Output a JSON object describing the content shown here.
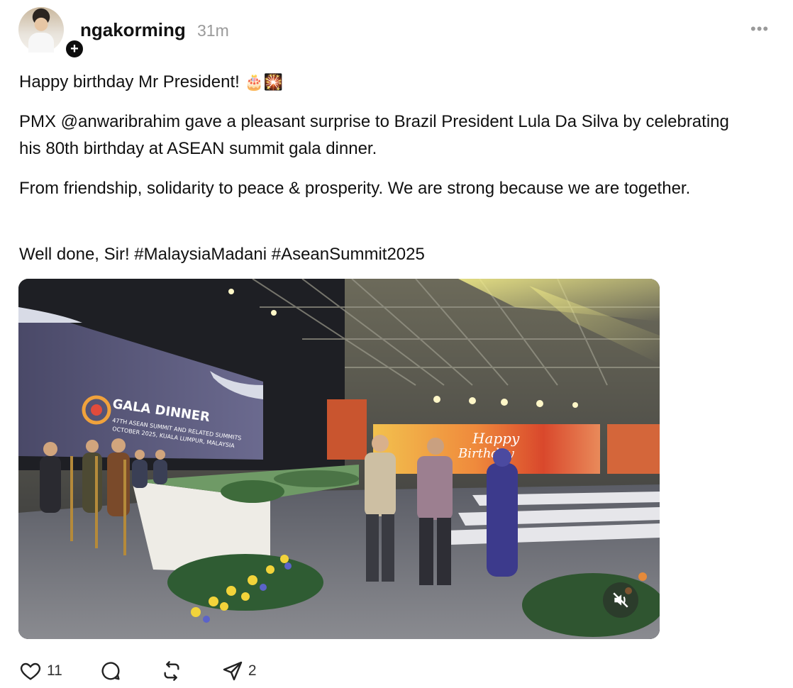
{
  "post": {
    "username": "ngakorming",
    "time": "31m",
    "more_label": "•••",
    "paragraphs": {
      "p1": "Happy birthday Mr President!",
      "p1_emoji": "🎂🎇",
      "p2": "PMX @anwaribrahim gave a pleasant surprise to Brazil President Lula Da Silva by celebrating his 80th birthday at ASEAN summit gala dinner.",
      "p3": "From friendship, solidarity to peace & prosperity. We are strong because we are together.",
      "p4": "Well done, Sir! #MalaysiaMadani #AseanSummit2025"
    }
  },
  "video": {
    "banner_title": "GALA DINNER",
    "banner_sub1": "47TH ASEAN SUMMIT AND RELATED SUMMITS",
    "banner_sub2": "OCTOBER 2025, KUALA LUMPUR, MALAYSIA",
    "screen_text_1": "Happy",
    "screen_text_2": "Birthday",
    "mute_icon": "speaker-muted-icon"
  },
  "actions": {
    "like_count": "11",
    "comment_count": "",
    "repost_count": "",
    "share_count": "2"
  },
  "colors": {
    "text": "#111111",
    "muted": "#9a9a9a",
    "badge": "#0d0d0d"
  }
}
